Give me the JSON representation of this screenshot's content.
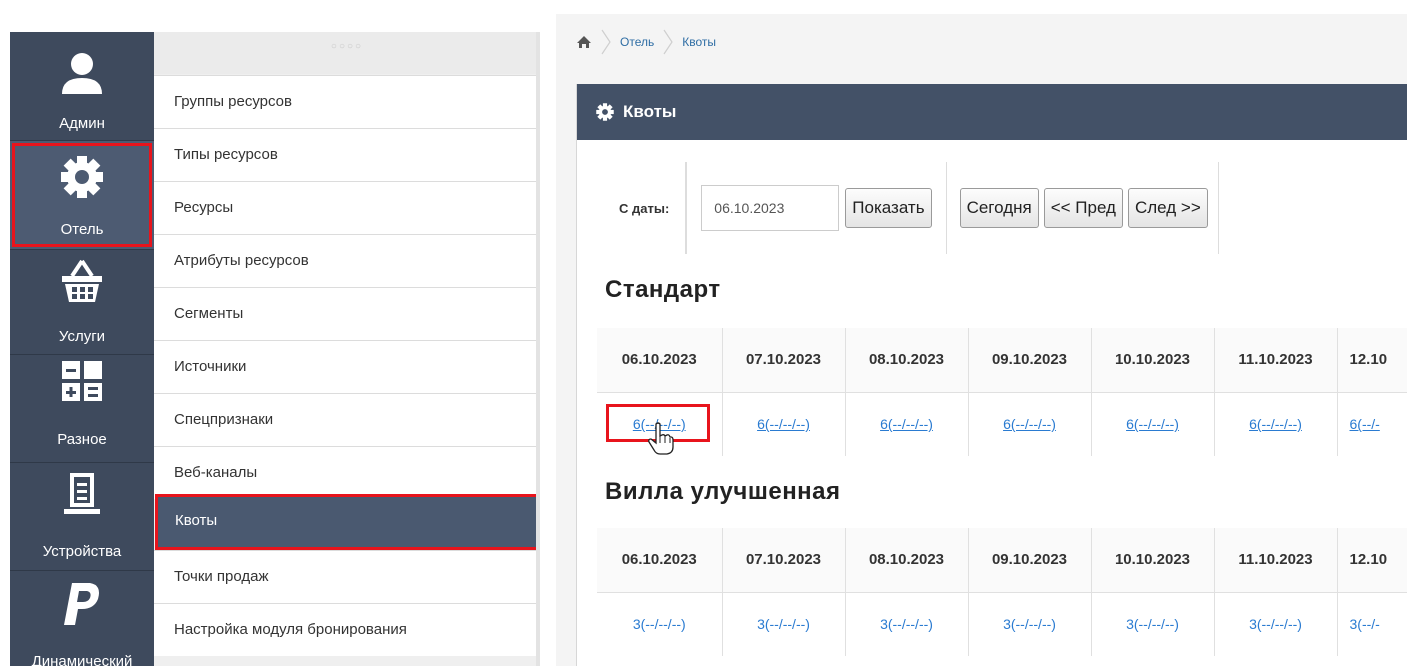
{
  "sidebar": {
    "items": [
      {
        "label": "Админ",
        "icon": "user-icon"
      },
      {
        "label": "Отель",
        "icon": "gear-icon"
      },
      {
        "label": "Услуги",
        "icon": "basket-icon"
      },
      {
        "label": "Разное",
        "icon": "calculator-icon"
      },
      {
        "label": "Устройства",
        "icon": "device-icon"
      },
      {
        "label": "Динамический",
        "icon": "paypal-icon"
      }
    ],
    "active": "Отель"
  },
  "submenu": {
    "grip": "○○○○",
    "items": [
      "Группы ресурсов",
      "Типы ресурсов",
      "Ресурсы",
      "Атрибуты ресурсов",
      "Сегменты",
      "Источники",
      "Спецпризнаки",
      "Веб-каналы",
      "Квоты",
      "Точки продаж",
      "Настройка модуля бронирования"
    ],
    "active": "Квоты"
  },
  "breadcrumb": {
    "home_icon": "home-icon",
    "items": [
      "Отель",
      "Квоты"
    ]
  },
  "panel": {
    "title": "Квоты",
    "icon": "gear-icon"
  },
  "toolbar": {
    "from_label": "С даты:",
    "date_value": "06.10.2023",
    "show_label": "Показать",
    "today_label": "Сегодня",
    "prev_label": "<< Пред",
    "next_label": "След >>"
  },
  "sections": [
    {
      "title": "Стандарт",
      "dates": [
        "06.10.2023",
        "07.10.2023",
        "08.10.2023",
        "09.10.2023",
        "10.10.2023",
        "11.10.2023",
        "12.10"
      ],
      "values": [
        "6(--/--/--)",
        "6(--/--/--)",
        "6(--/--/--)",
        "6(--/--/--)",
        "6(--/--/--)",
        "6(--/--/--)",
        "6(--/-"
      ]
    },
    {
      "title": "Вилла улучшенная",
      "dates": [
        "06.10.2023",
        "07.10.2023",
        "08.10.2023",
        "09.10.2023",
        "10.10.2023",
        "11.10.2023",
        "12.10"
      ],
      "values": [
        "3(--/--/--)",
        "3(--/--/--)",
        "3(--/--/--)",
        "3(--/--/--)",
        "3(--/--/--)",
        "3(--/--/--)",
        "3(--/-"
      ]
    }
  ],
  "colors": {
    "sidebar": "#3e4a5d",
    "header": "#435167",
    "highlight": "#e8141c",
    "link": "#2a7bd1"
  }
}
